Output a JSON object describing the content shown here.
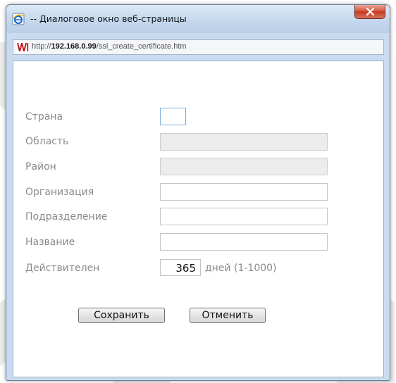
{
  "window": {
    "title": "-- Диалоговое окно веб-страницы",
    "url_prefix": "http://",
    "url_host": "192.168.0.99",
    "url_path": "/ssl_create_certificate.htm"
  },
  "form": {
    "country_label": "Страна",
    "region_label": "Область",
    "district_label": "Район",
    "organization_label": "Организация",
    "department_label": "Подразделение",
    "name_label": "Название",
    "valid_label": "Действителен",
    "valid_value": "365",
    "valid_units": "дней (1-1000)"
  },
  "buttons": {
    "save": "Сохранить",
    "cancel": "Отменить"
  },
  "colors": {
    "titlebar": "#c3d6ec",
    "close_button": "#c43a22",
    "label_text": "#8a8a8a"
  }
}
